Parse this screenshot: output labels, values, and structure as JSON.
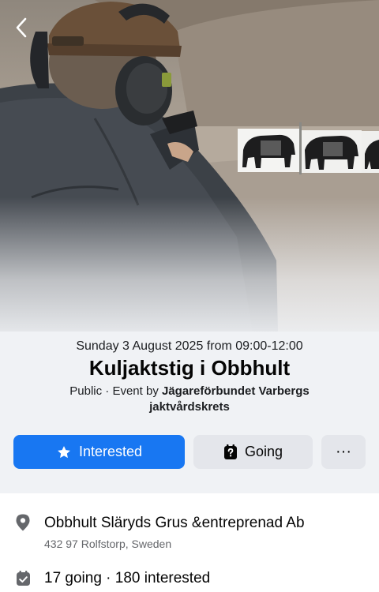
{
  "event": {
    "date_time": "Sunday 3 August 2025 from 09:00-12:00",
    "title": "Kuljaktstig i Obbhult",
    "meta_prefix": "Public · Event by ",
    "organizer": "Jägareförbundet Varbergs jaktvårdskrets"
  },
  "actions": {
    "interested_label": "Interested",
    "going_label": "Going",
    "more_label": "···"
  },
  "location": {
    "name": "Obbhult Släryds Grus &entreprenad Ab",
    "address": "432 97 Rolfstorp, Sweden"
  },
  "attendance": {
    "summary": "17 going · 180 interested"
  },
  "colors": {
    "primary": "#1877f2",
    "secondary_button": "#e4e6eb",
    "header_background": "#f0f2f5",
    "muted_text": "#65676b"
  },
  "icons": {
    "back": "chevron-left-icon",
    "interested": "star-icon",
    "going": "question-calendar-icon",
    "location": "map-pin-icon",
    "attendance": "calendar-check-icon"
  }
}
